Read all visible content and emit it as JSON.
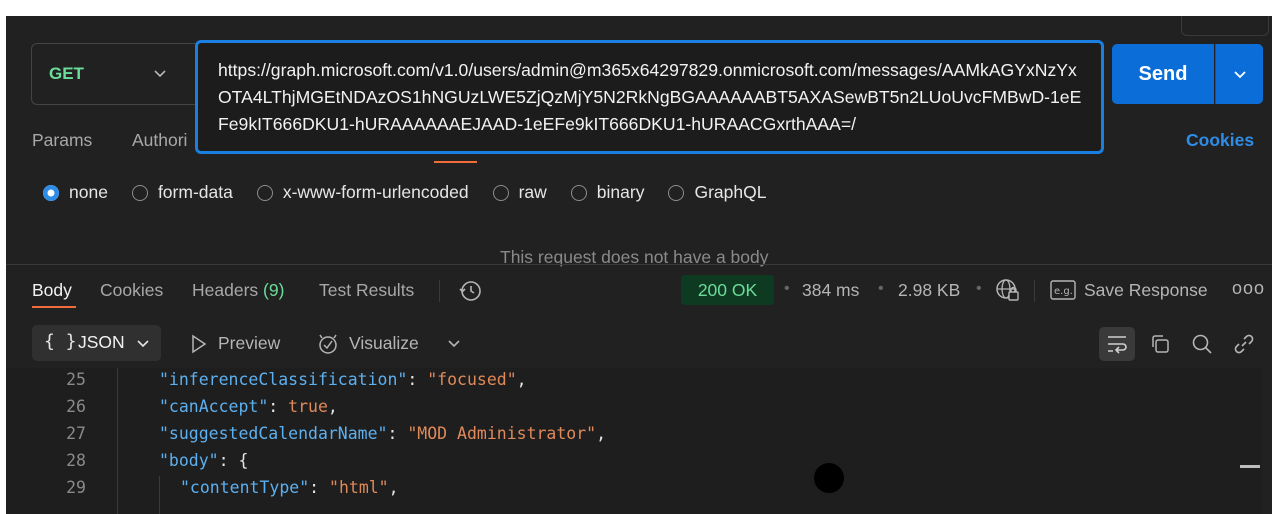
{
  "request": {
    "method": "GET",
    "url": "https://graph.microsoft.com/v1.0/users/admin@m365x64297829.onmicrosoft.com/messages/AAMkAGYxNzYxOTA4LThjMGEtNDAzOS1hNGUzLWE5ZjQzMjY5N2RkNgBGAAAAAABT5AXASewBT5n2LUoUvcFMBwD-1eEFe9kIT666DKU1-hURAAAAAAEJAAD-1eEFe9kIT666DKU1-hURAACGxrthAAA=/",
    "send_label": "Send"
  },
  "request_tabs": {
    "params": "Params",
    "authorization": "Authori",
    "cookies": "Cookies"
  },
  "body_types": [
    "none",
    "form-data",
    "x-www-form-urlencoded",
    "raw",
    "binary",
    "GraphQL"
  ],
  "body_type_selected": "none",
  "no_body_message": "This request does not have a body",
  "response_tabs": {
    "body": "Body",
    "cookies": "Cookies",
    "headers": "Headers",
    "headers_count": "(9)",
    "test_results": "Test Results"
  },
  "response_meta": {
    "status": "200 OK",
    "time": "384 ms",
    "size": "2.98 KB",
    "save_response": "Save Response",
    "more": "ooo"
  },
  "viewer": {
    "format": "JSON",
    "preview": "Preview",
    "visualize": "Visualize"
  },
  "colors": {
    "accent_blue": "#1a7fe0",
    "send_blue": "#0b6ed8",
    "method_green": "#6bdd9a",
    "tab_orange": "#f26b3a",
    "json_key": "#5db0f0",
    "json_string": "#e0895a"
  },
  "code_lines": [
    {
      "n": "25",
      "indent": 2,
      "key": "inferenceClassification",
      "value": "\"focused\"",
      "value_type": "string",
      "trail": ","
    },
    {
      "n": "26",
      "indent": 2,
      "key": "canAccept",
      "value": "true",
      "value_type": "bool",
      "trail": ","
    },
    {
      "n": "27",
      "indent": 2,
      "key": "suggestedCalendarName",
      "value": "\"MOD Administrator\"",
      "value_type": "string",
      "trail": ","
    },
    {
      "n": "28",
      "indent": 2,
      "key": "body",
      "value": "{",
      "value_type": "punct",
      "trail": ""
    },
    {
      "n": "29",
      "indent": 3,
      "key": "contentType",
      "value": "\"html\"",
      "value_type": "string",
      "trail": ","
    }
  ]
}
